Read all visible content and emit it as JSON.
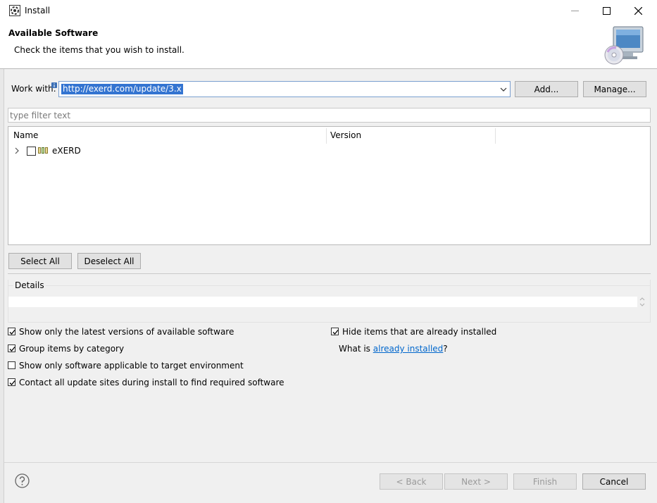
{
  "window": {
    "title": "Install"
  },
  "header": {
    "title": "Available Software",
    "description": "Check the items that you wish to install."
  },
  "workwith": {
    "label": "Work with:",
    "value": "http://exerd.com/update/3.x",
    "add_label": "Add...",
    "manage_label": "Manage..."
  },
  "filter": {
    "placeholder": "type filter text"
  },
  "tree": {
    "columns": [
      "Name",
      "Version"
    ],
    "rows": [
      {
        "name": "eXERD",
        "version": ""
      }
    ]
  },
  "selection": {
    "select_all": "Select All",
    "deselect_all": "Deselect All"
  },
  "details": {
    "label": "Details"
  },
  "options": {
    "latest_versions": {
      "label": "Show only the latest versions of available software",
      "checked": true
    },
    "group_by_category": {
      "label": "Group items by category",
      "checked": true
    },
    "applicable_only": {
      "label": "Show only software applicable to target environment",
      "checked": false
    },
    "contact_all": {
      "label": "Contact all update sites during install to find required software",
      "checked": true
    },
    "hide_installed": {
      "label": "Hide items that are already installed",
      "checked": true
    },
    "what_is_prefix": "What is ",
    "what_is_link": "already installed",
    "what_is_suffix": "?"
  },
  "footer": {
    "back": "< Back",
    "next": "Next >",
    "finish": "Finish",
    "cancel": "Cancel"
  },
  "colors": {
    "accent": "#3374d1",
    "link": "#0066cc"
  }
}
